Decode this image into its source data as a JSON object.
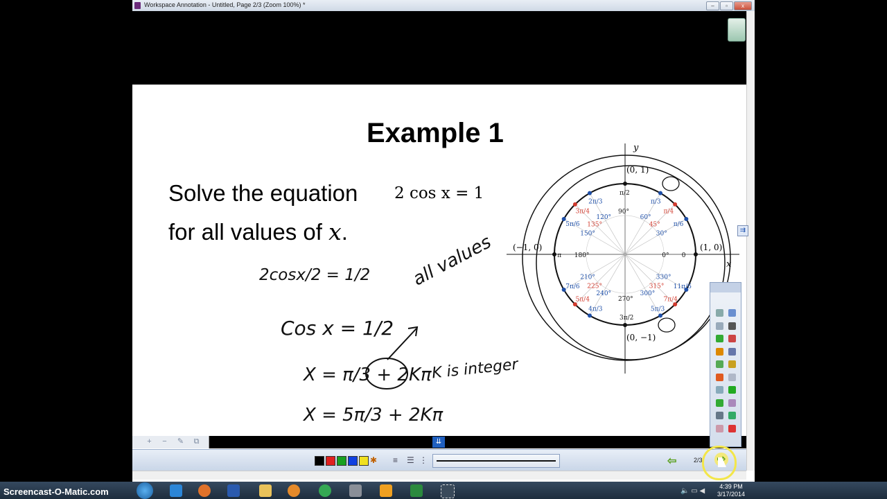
{
  "window": {
    "title": "Workspace Annotation - Untitled, Page 2/3  (Zoom 100%) *",
    "controls": [
      "–",
      "▫",
      "x"
    ]
  },
  "slide": {
    "title": "Example 1",
    "line1": "Solve the equation",
    "equation": "2 cos x = 1",
    "line2_prefix": "for all values of ",
    "line2_var": "x",
    "line2_suffix": "."
  },
  "handwriting": {
    "step1": "2cosx/2 = 1/2",
    "step2": "Cos x = 1/2",
    "step3": "X = π/3 + 2Kπ",
    "step4": "X = 5π/3 + 2Kπ",
    "note_all_values": "all values",
    "note_k": "K is integer"
  },
  "unit_circle": {
    "axis_x": "x",
    "axis_y": "y",
    "points": {
      "top": "(0, 1)",
      "left": "(−1, 0)",
      "right": "(1, 0)",
      "bottom": "(0, −1)"
    },
    "angles_deg": [
      "90°",
      "60°",
      "45°",
      "30°",
      "0°",
      "120°",
      "135°",
      "150°",
      "180°",
      "210°",
      "225°",
      "240°",
      "270°",
      "300°",
      "315°",
      "330°"
    ],
    "angles_rad": [
      "π/2",
      "π/3",
      "π/4",
      "π/6",
      "0",
      "2π/3",
      "3π/4",
      "5π/6",
      "π",
      "7π/6",
      "5π/4",
      "4π/3",
      "3π/2",
      "5π/3",
      "7π/4",
      "11π/6"
    ],
    "colors": {
      "blue": "#1e4fa8",
      "red": "#d23b2e",
      "ink": "#111111"
    }
  },
  "drawing_toolbar": {
    "colors": [
      "#000000",
      "#e02020",
      "#18a020",
      "#1040e0",
      "#f0e020"
    ],
    "page_counter": "2/3"
  },
  "taskbar": {
    "watermark": "Screencast-O-Matic.com",
    "time": "4:39 PM",
    "date": "3/17/2014"
  }
}
